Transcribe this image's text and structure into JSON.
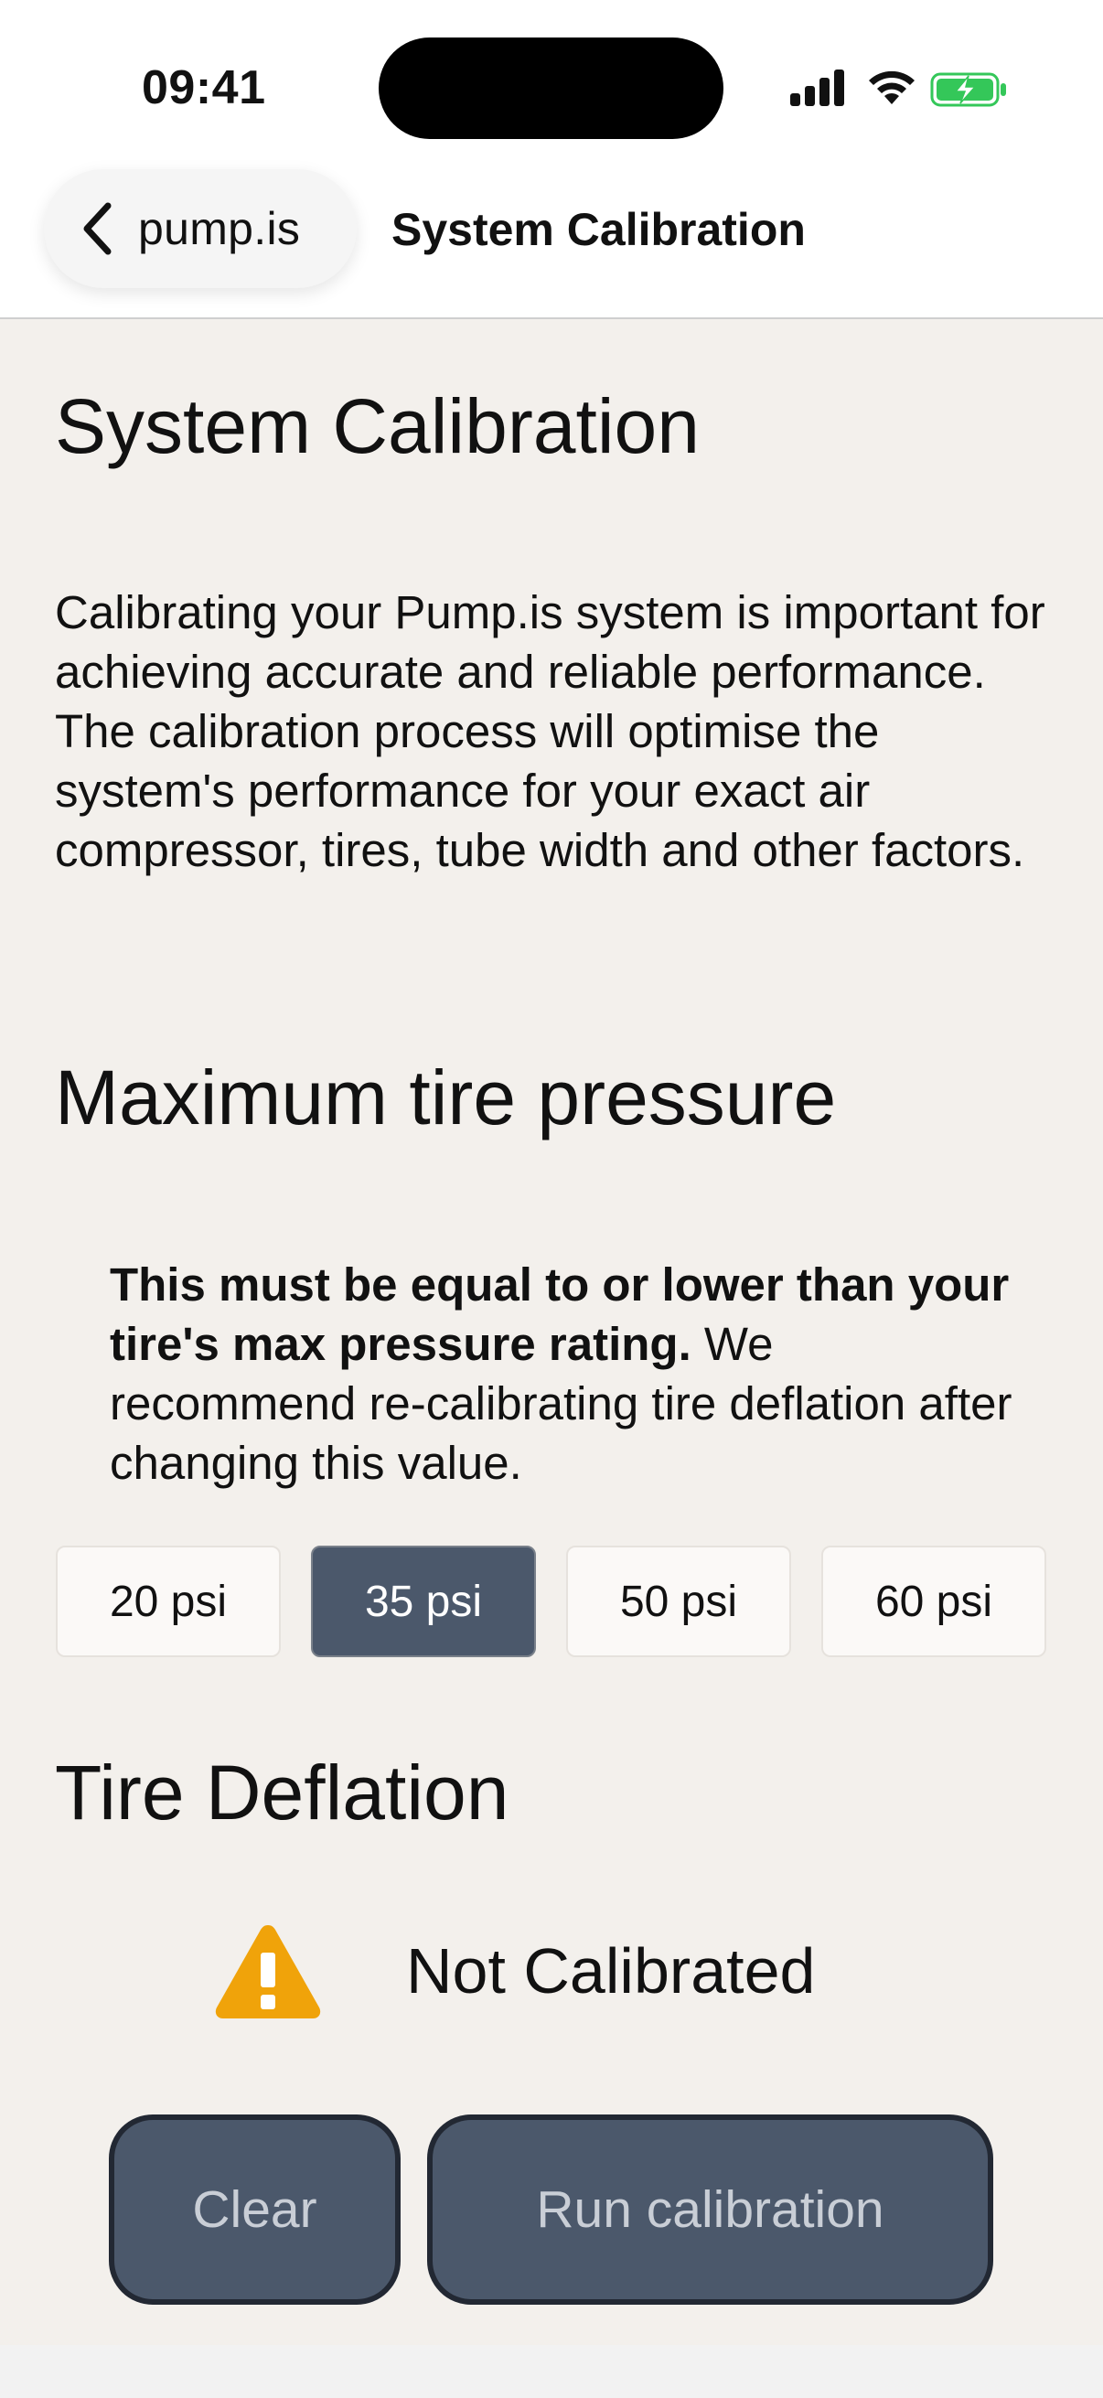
{
  "status_bar": {
    "time": "09:41"
  },
  "nav": {
    "back_label": "pump.is",
    "title": "System Calibration"
  },
  "page": {
    "heading": "System Calibration",
    "intro": "Calibrating your Pump.is system is important for achieving accurate and reliable performance. The calibration process will optimise the system's performance for your exact air compressor, tires, tube width and other factors."
  },
  "max_pressure": {
    "heading": "Maximum tire pressure",
    "note_bold": "This must be equal to or lower than your tire's max pressure rating.",
    "note_rest": " We recommend re-calibrating tire deflation after changing this value.",
    "options": [
      "20 psi",
      "35 psi",
      "50 psi",
      "60 psi"
    ],
    "selected": "35 psi"
  },
  "deflation": {
    "heading": "Tire Deflation",
    "status": "Not Calibrated",
    "status_icon": "warning-icon",
    "clear_label": "Clear",
    "run_label": "Run calibration"
  },
  "colors": {
    "background": "#f3f0ec",
    "accent": "#4b586b",
    "warning": "#f0a30a",
    "battery": "#34c759"
  }
}
